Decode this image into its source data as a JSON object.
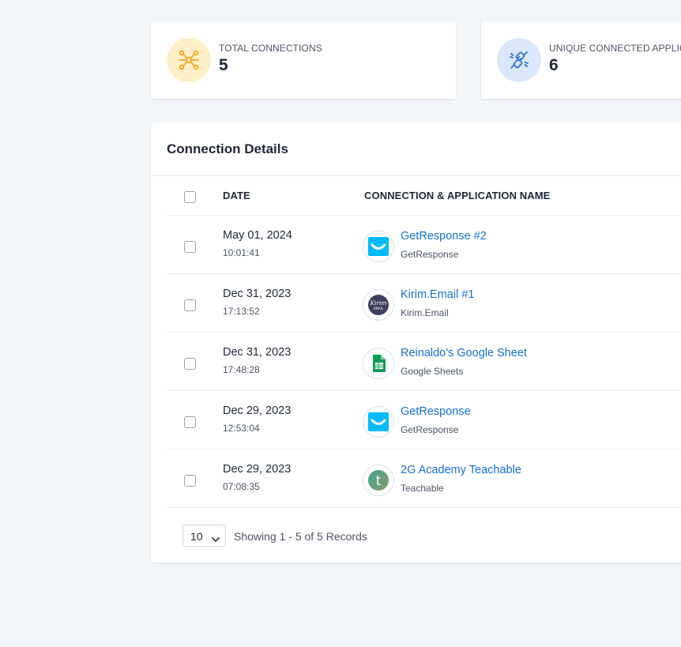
{
  "stats": [
    {
      "label": "TOTAL CONNECTIONS",
      "value": "5",
      "icon": "network-icon",
      "color": "#f5a623"
    },
    {
      "label": "UNIQUE CONNECTED APPLICATIONS",
      "value": "6",
      "icon": "plug-icon",
      "color": "#2f6fd6"
    }
  ],
  "panel": {
    "title": "Connection Details",
    "columns": {
      "date": "DATE",
      "connection": "CONNECTION & APPLICATION NAME"
    },
    "rows": [
      {
        "date": "May 01, 2024",
        "time": "10:01:41",
        "connection": "GetResponse #2",
        "app": "GetResponse",
        "logo": "getresponse-icon"
      },
      {
        "date": "Dec 31, 2023",
        "time": "17:13:52",
        "connection": "Kirim.Email #1",
        "app": "Kirim.Email",
        "logo": "kirim-email-icon"
      },
      {
        "date": "Dec 31, 2023",
        "time": "17:48:28",
        "connection": "Reinaldo's Google Sheet",
        "app": "Google Sheets",
        "logo": "google-sheets-icon"
      },
      {
        "date": "Dec 29, 2023",
        "time": "12:53:04",
        "connection": "GetResponse",
        "app": "GetResponse",
        "logo": "getresponse-icon"
      },
      {
        "date": "Dec 29, 2023",
        "time": "07:08:35",
        "connection": "2G Academy Teachable",
        "app": "Teachable",
        "logo": "teachable-icon"
      }
    ],
    "pagination": {
      "page_size": "10",
      "summary": "Showing 1 - 5 of 5 Records"
    }
  },
  "logos": {
    "kirim_email_top": "Kirim",
    "kirim_email_bottom": "EMAIL",
    "teachable_letter": "t"
  },
  "colors": {
    "link": "#1570d6",
    "getresponse": "#00baff",
    "google_sheets": "#0f9d58",
    "kirim_email": "#3b3f5c",
    "teachable": "#4c9e86"
  }
}
